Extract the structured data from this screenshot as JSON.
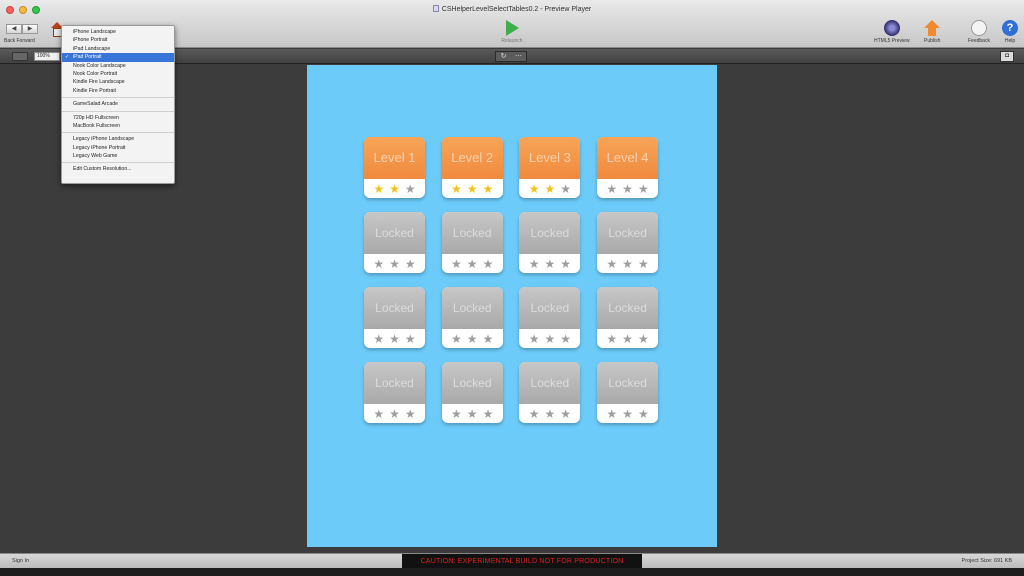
{
  "window": {
    "title": "CSHelperLevelSelectTables0.2 - Preview Player"
  },
  "toolbar": {
    "back_label": "◀",
    "forward_label": "▶",
    "nav_caption": "Back  Forward",
    "play_label": "Relaunch",
    "html5_label": "HTML5 Preview",
    "publish_label": "Publish",
    "feedback_label": "Feedback",
    "help_label": "Help",
    "help_glyph": "?"
  },
  "subbar": {
    "zoom": "100%",
    "refresh_glyph": "↻",
    "extra_glyph": "⋯",
    "camera_glyph": "◘"
  },
  "device_menu": {
    "items": [
      {
        "label": "iPhone Landscape",
        "selected": false
      },
      {
        "label": "iPhone Portrait",
        "selected": false
      },
      {
        "label": "iPad Landscape",
        "selected": false
      },
      {
        "label": "iPad Portrait",
        "selected": true
      },
      {
        "label": "Nook Color Landscape",
        "selected": false
      },
      {
        "label": "Nook Color Portrait",
        "selected": false
      },
      {
        "label": "Kindle Fire Landscape",
        "selected": false
      },
      {
        "label": "Kindle Fire Portrait",
        "selected": false
      },
      {
        "sep": true
      },
      {
        "label": "GameSalad Arcade",
        "selected": false
      },
      {
        "sep": true
      },
      {
        "label": "720p HD Fullscreen",
        "selected": false
      },
      {
        "label": "MacBook Fullscreen",
        "selected": false
      },
      {
        "sep": true
      },
      {
        "label": "Legacy iPhone Landscape",
        "selected": false
      },
      {
        "label": "Legacy iPhone Portrait",
        "selected": false
      },
      {
        "label": "Legacy Web Game",
        "selected": false
      },
      {
        "sep": true
      },
      {
        "label": "Edit Custom Resolution...",
        "selected": false
      }
    ]
  },
  "levels": [
    {
      "label": "Level 1",
      "locked": false,
      "stars": 2
    },
    {
      "label": "Level 2",
      "locked": false,
      "stars": 3
    },
    {
      "label": "Level 3",
      "locked": false,
      "stars": 2
    },
    {
      "label": "Level 4",
      "locked": false,
      "stars": 0
    },
    {
      "label": "Locked",
      "locked": true,
      "stars": 0
    },
    {
      "label": "Locked",
      "locked": true,
      "stars": 0
    },
    {
      "label": "Locked",
      "locked": true,
      "stars": 0
    },
    {
      "label": "Locked",
      "locked": true,
      "stars": 0
    },
    {
      "label": "Locked",
      "locked": true,
      "stars": 0
    },
    {
      "label": "Locked",
      "locked": true,
      "stars": 0
    },
    {
      "label": "Locked",
      "locked": true,
      "stars": 0
    },
    {
      "label": "Locked",
      "locked": true,
      "stars": 0
    },
    {
      "label": "Locked",
      "locked": true,
      "stars": 0
    },
    {
      "label": "Locked",
      "locked": true,
      "stars": 0
    },
    {
      "label": "Locked",
      "locked": true,
      "stars": 0
    },
    {
      "label": "Locked",
      "locked": true,
      "stars": 0
    }
  ],
  "star_glyph": "★",
  "star_total": 3,
  "statusbar": {
    "signin": "Sign In",
    "caution": "CAUTION: EXPERIMENTAL BUILD NOT FOR PRODUCTION",
    "project_size": "Project Size: 691 KB"
  },
  "colors": {
    "canvas_bg": "#6ccbf8",
    "tile_unlocked": "#f08a3e",
    "tile_locked": "#a9a9a9",
    "star_on": "#f4c21c",
    "star_off": "#9e9e9e",
    "caution_text": "#e02020"
  }
}
